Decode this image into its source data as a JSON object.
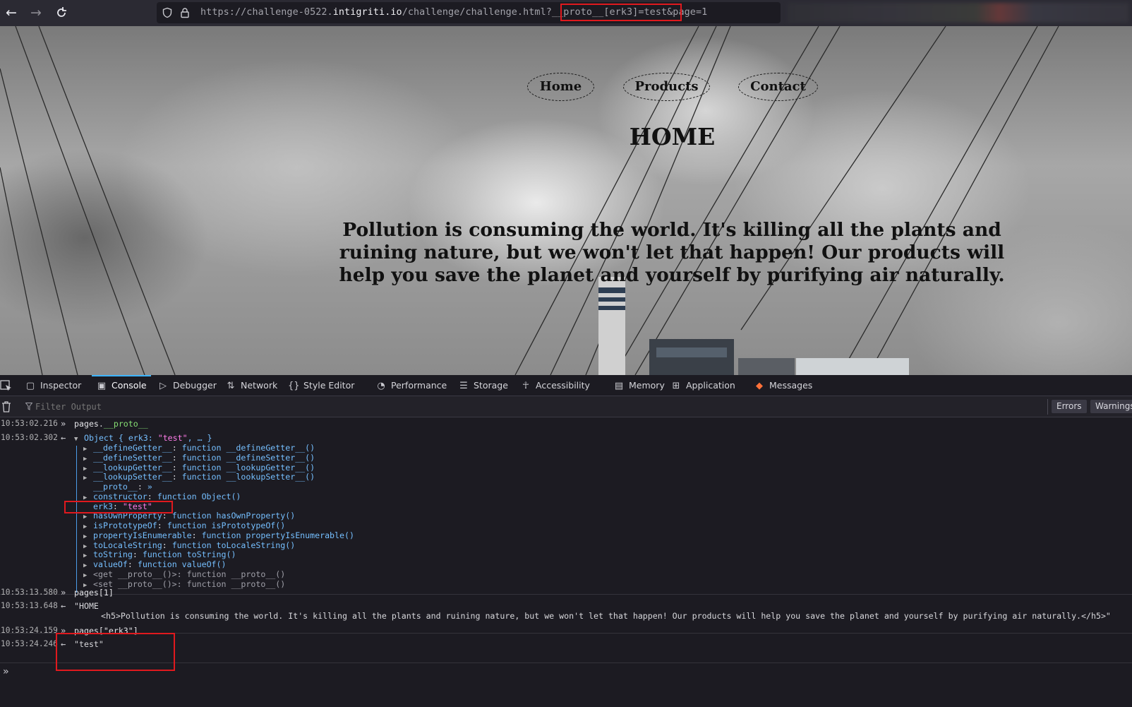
{
  "browser": {
    "url_prefix": "https://challenge-0522.",
    "url_host": "intigriti.io",
    "url_path": "/challenge/challenge.html?",
    "url_query": "__proto__[erk3]=test&page=1"
  },
  "page": {
    "nav": [
      "Home",
      "Products",
      "Contact"
    ],
    "heading": "HOME",
    "message": "Pollution is consuming the world. It's killing all the plants and ruining nature, but we won't let that happen! Our products will help you save the planet and yourself by purifying air naturally."
  },
  "devtools": {
    "tabs": [
      "Inspector",
      "Console",
      "Debugger",
      "Network",
      "Style Editor",
      "Performance",
      "Storage",
      "Accessibility",
      "Memory",
      "Application",
      "Messages"
    ],
    "active_tab": "Console",
    "filter_placeholder": "Filter Output",
    "filter_buttons": [
      "Errors",
      "Warnings"
    ]
  },
  "console": {
    "entries": [
      {
        "time": "10:53:02.216",
        "dir": "in",
        "segments": [
          [
            "pages",
            "c-id"
          ],
          [
            ".",
            "c-plain"
          ],
          [
            "__proto__",
            "c-prop"
          ]
        ]
      },
      {
        "time": "10:53:02.302",
        "dir": "out",
        "segments": [
          [
            "Object { ",
            "c-kw"
          ],
          [
            "erk3",
            "c-kw"
          ],
          [
            ": ",
            "c-kw"
          ],
          [
            "\"test\"",
            "c-str"
          ],
          [
            ", … }",
            "c-kw"
          ]
        ]
      }
    ],
    "tree": [
      {
        "twisty": true,
        "key": "__defineGetter__",
        "val": "function __defineGetter__()"
      },
      {
        "twisty": true,
        "key": "__defineSetter__",
        "val": "function __defineSetter__()"
      },
      {
        "twisty": true,
        "key": "__lookupGetter__",
        "val": "function __lookupGetter__()"
      },
      {
        "twisty": true,
        "key": "__lookupSetter__",
        "val": "function __lookupSetter__()"
      },
      {
        "twisty": false,
        "key": "__proto__",
        "val": "»"
      },
      {
        "twisty": true,
        "key": "constructor",
        "val": "function Object()"
      },
      {
        "twisty": false,
        "key": "erk3",
        "val": "\"test\"",
        "str": true
      },
      {
        "twisty": true,
        "key": "hasOwnProperty",
        "val": "function hasOwnProperty()"
      },
      {
        "twisty": true,
        "key": "isPrototypeOf",
        "val": "function isPrototypeOf()"
      },
      {
        "twisty": true,
        "key": "propertyIsEnumerable",
        "val": "function propertyIsEnumerable()"
      },
      {
        "twisty": true,
        "key": "toLocaleString",
        "val": "function toLocaleString()"
      },
      {
        "twisty": true,
        "key": "toString",
        "val": "function toString()"
      },
      {
        "twisty": true,
        "key": "valueOf",
        "val": "function valueOf()"
      },
      {
        "twisty": true,
        "key": "<get __proto__()>",
        "val": "function __proto__()",
        "gray": true
      },
      {
        "twisty": true,
        "key": "<set __proto__()>",
        "val": "function __proto__()",
        "gray": true
      }
    ],
    "later": [
      {
        "time": "10:53:13.580",
        "dir": "in",
        "text": "pages[1]"
      },
      {
        "time": "10:53:13.648",
        "dir": "out",
        "text": "\"HOME"
      },
      {
        "time": "",
        "dir": "",
        "text": "<h5>Pollution is consuming the world. It's killing all the plants and ruining nature, but we won't let that happen! Our products will help you save the planet and yourself by purifying air naturally.</h5>\""
      },
      {
        "time": "10:53:24.159",
        "dir": "in",
        "text": "pages[\"erk3\"]"
      },
      {
        "time": "10:53:24.246",
        "dir": "out",
        "text": "\"test\""
      }
    ]
  },
  "colors": {
    "highlight": "#e0191e",
    "active_tab_indicator": "#3db5ff"
  }
}
